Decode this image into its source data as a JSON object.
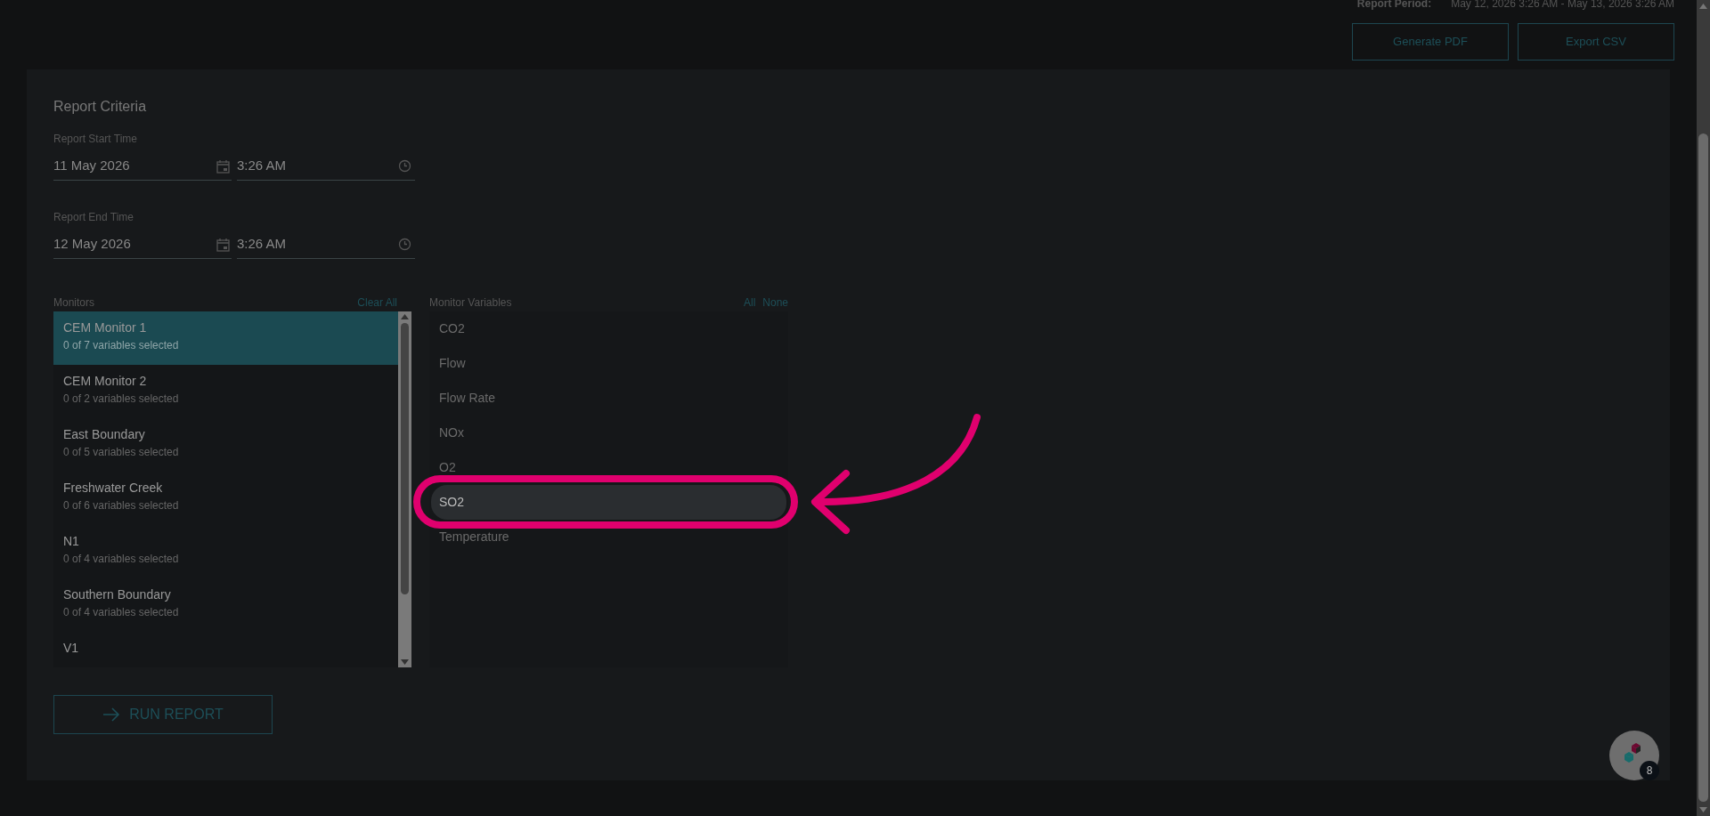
{
  "report_period": {
    "label": "Report Period:",
    "value": "May 12, 2026 3:26 AM - May 13, 2026 3:26 AM"
  },
  "actions": [
    "Generate PDF",
    "Export CSV"
  ],
  "criteria": {
    "title": "Report Criteria",
    "times": [
      {
        "label": "Report Start Time",
        "date": "11 May 2026",
        "time": "3:26 AM"
      },
      {
        "label": "Report End Time",
        "date": "12 May 2026",
        "time": "3:26 AM"
      }
    ]
  },
  "monitors": {
    "title": "Clear All",
    "heading": "Monitors",
    "items": [
      {
        "name": "CEM Monitor 1",
        "detail": "0 of 7 variables selected",
        "selected": true
      },
      {
        "name": "CEM Monitor 2",
        "detail": "0 of 2 variables selected",
        "selected": false
      },
      {
        "name": "East Boundary",
        "detail": "0 of 5 variables selected",
        "selected": false
      },
      {
        "name": "Freshwater Creek",
        "detail": "0 of 6 variables selected",
        "selected": false
      },
      {
        "name": "N1",
        "detail": "0 of 4 variables selected",
        "selected": false
      },
      {
        "name": "Southern Boundary",
        "detail": "0 of 4 variables selected",
        "selected": false
      },
      {
        "name": "V1",
        "selected": false
      }
    ]
  },
  "variables": {
    "heading": "Monitor Variables",
    "links": [
      "All",
      "None"
    ],
    "items": [
      {
        "name": "CO2",
        "highlighted": false
      },
      {
        "name": "Flow",
        "highlighted": false
      },
      {
        "name": "Flow Rate",
        "highlighted": false
      },
      {
        "name": "NOx",
        "highlighted": false
      },
      {
        "name": "O2",
        "highlighted": false
      },
      {
        "name": "SO2",
        "highlighted": true
      },
      {
        "name": "Temperature",
        "highlighted": false
      }
    ]
  },
  "run_button": "RUN REPORT",
  "help_badge": "8"
}
